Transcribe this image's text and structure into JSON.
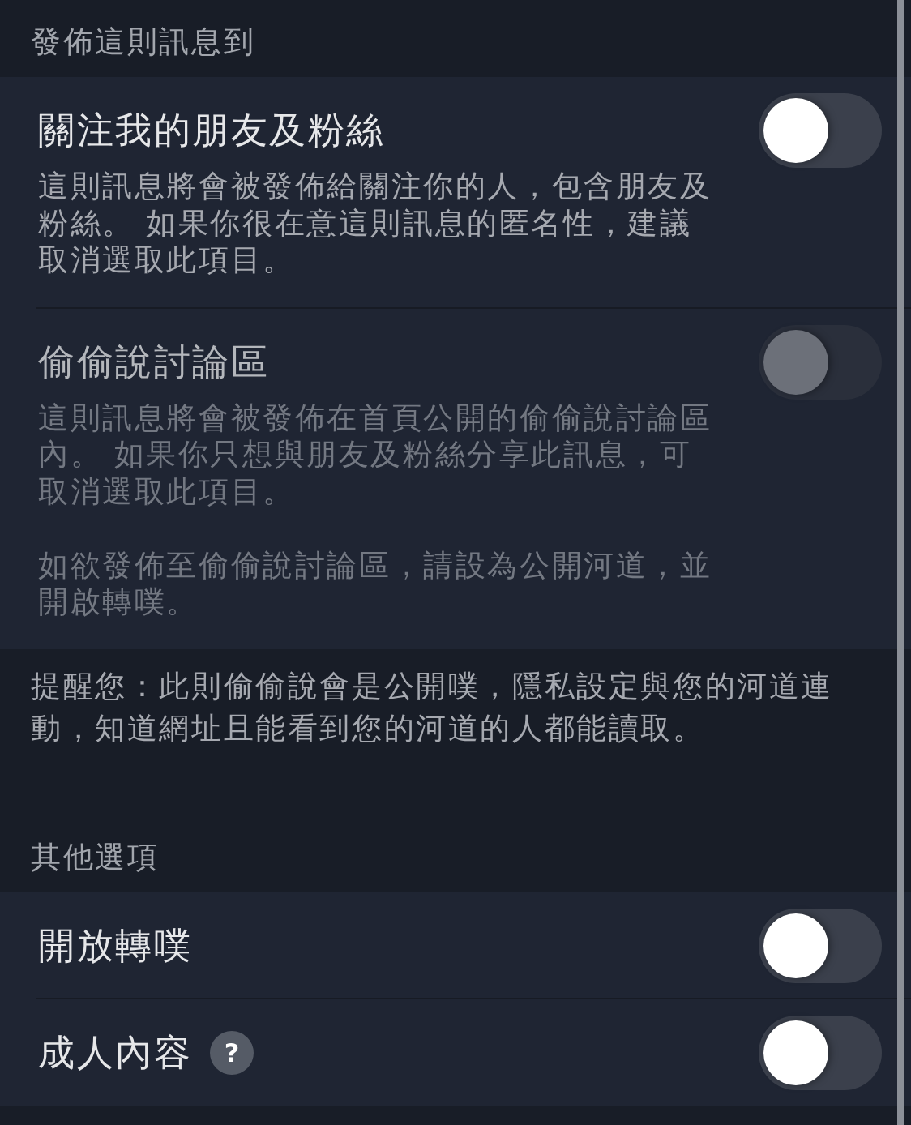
{
  "sections": [
    {
      "header": "發佈這則訊息到",
      "items": [
        {
          "title": "關注我的朋友及粉絲",
          "description": [
            "這則訊息將會被發佈給關注你的人，包含朋友及粉絲。 如果你很在意這則訊息的匿名性，建議取消選取此項目。"
          ],
          "on": false,
          "disabled": false
        },
        {
          "title": "偷偷說討論區",
          "description": [
            "這則訊息將會被發佈在首頁公開的偷偷說討論區內。 如果你只想與朋友及粉絲分享此訊息，可取消選取此項目。",
            "如欲發佈至偷偷說討論區，請設為公開河道，並開啟轉噗。"
          ],
          "on": false,
          "disabled": true
        }
      ],
      "note": "提醒您：此則偷偷說會是公開噗，隱私設定與您的河道連動，知道網址且能看到您的河道的人都能讀取。"
    },
    {
      "header": "其他選項",
      "items": [
        {
          "title": "開放轉噗",
          "on": false,
          "disabled": false
        },
        {
          "title": "成人內容",
          "help": "?",
          "on": false,
          "disabled": false
        }
      ]
    }
  ]
}
